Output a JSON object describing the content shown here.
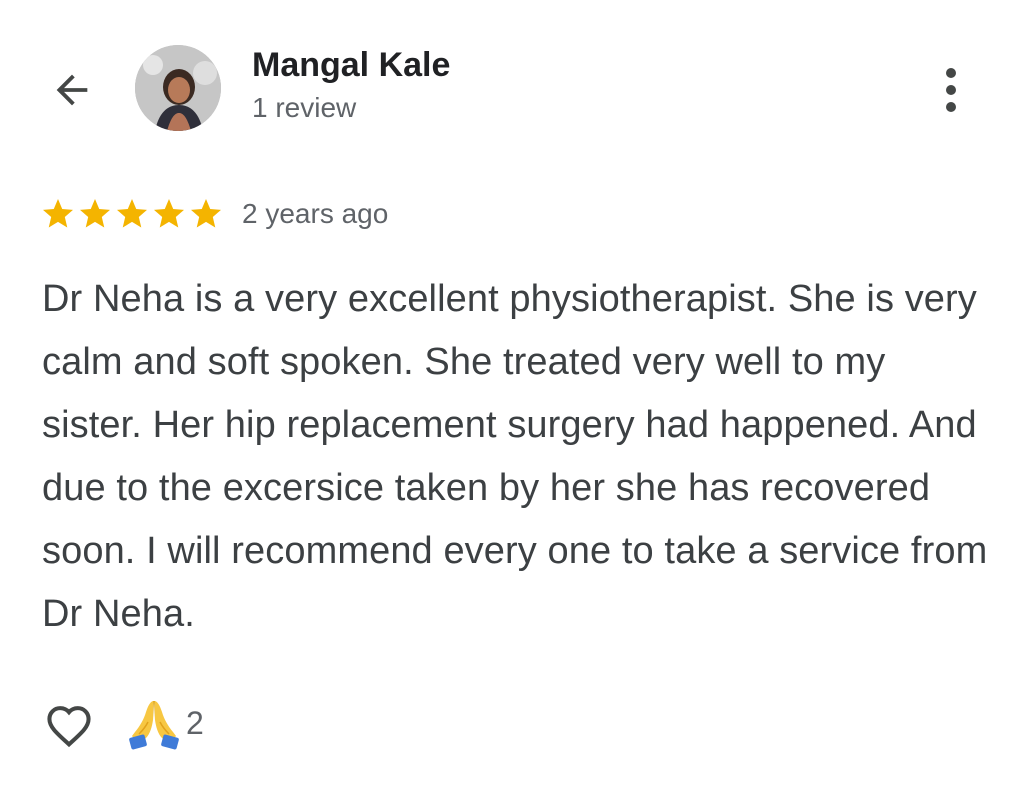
{
  "reviewer": {
    "name": "Mangal Kale",
    "review_count": "1 review"
  },
  "review": {
    "rating": 5,
    "max_rating": 5,
    "time_ago": "2 years ago",
    "text": "Dr Neha is a very excellent physiotherapist. She is very calm and soft spoken. She treated very well to my sister. Her hip replacement surgery had happened. And due to the excersice taken by her she has recovered soon. I will recommend every one to take a service from Dr Neha."
  },
  "actions": {
    "reaction_count": "2"
  },
  "icons": {
    "back": "arrow-left-icon",
    "more": "more-vertical-icon",
    "star": "star-icon",
    "like": "heart-icon",
    "reaction": "folded-hands-icon"
  },
  "colors": {
    "star": "#F4B400",
    "text_primary": "#202124",
    "text_secondary": "#5f6368",
    "icon": "#444746"
  }
}
